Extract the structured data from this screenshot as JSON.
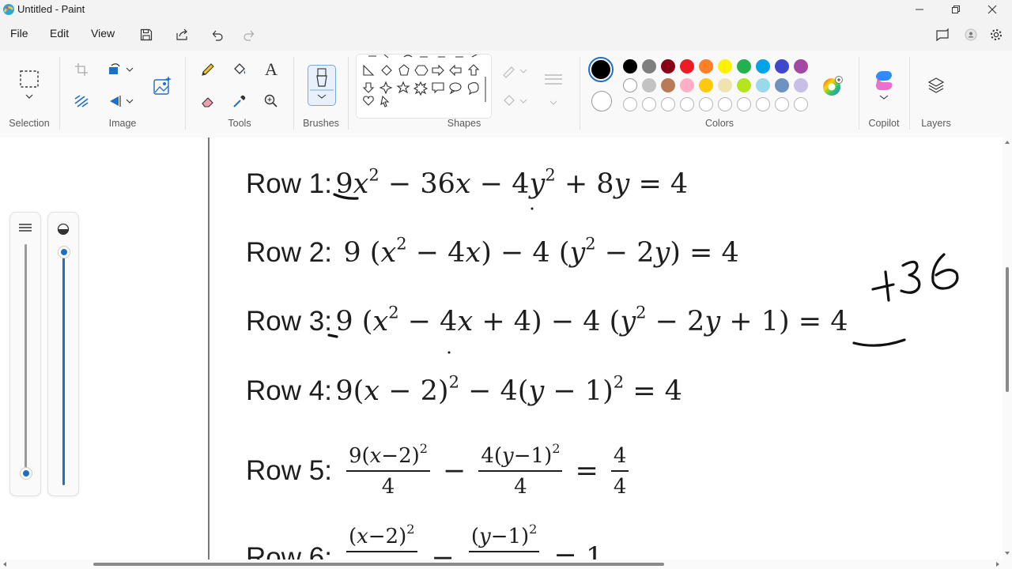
{
  "window": {
    "title": "Untitled - Paint"
  },
  "menu": {
    "file": "File",
    "edit": "Edit",
    "view": "View"
  },
  "ribbon": {
    "groups": {
      "selection": "Selection",
      "image": "Image",
      "tools": "Tools",
      "brushes": "Brushes",
      "shapes": "Shapes",
      "colors": "Colors",
      "copilot": "Copilot",
      "layers": "Layers"
    },
    "tools_text_glyph": "A",
    "colors_primary": "#000000",
    "colors_secondary": "#ffffff",
    "palette_row1": [
      "#000000",
      "#7f7f7f",
      "#880015",
      "#ed1c24",
      "#ff7f27",
      "#fff200",
      "#22b14c",
      "#00a2e8",
      "#3f48cc",
      "#a349a4"
    ],
    "palette_row2": [
      "#ffffff",
      "#c3c3c3",
      "#b97a57",
      "#ffaec9",
      "#ffc90e",
      "#efe4b0",
      "#b5e61d",
      "#99d9ea",
      "#7092be",
      "#c8bfe7"
    ]
  },
  "canvas": {
    "rows": [
      {
        "label": "Row 1:"
      },
      {
        "label": "Row 2:"
      },
      {
        "label": "Row 3:"
      },
      {
        "label": "Row 4:"
      },
      {
        "label": "Row 5:"
      },
      {
        "label": "Row 6:"
      }
    ],
    "annotation": "+36"
  }
}
